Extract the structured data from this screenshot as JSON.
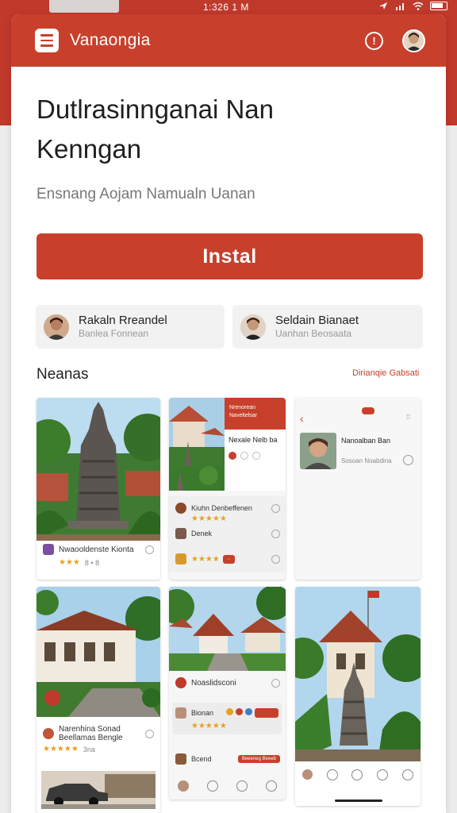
{
  "status_bar": {
    "time": "1:326 1 M"
  },
  "header": {
    "app_name": "Vanaongia",
    "info_glyph": "!"
  },
  "hero": {
    "title_line1": "Dutlrasinnganai Nan",
    "title_line2": "Kenngan",
    "subtitle": "Ensnang Aojam Namualn Uanan",
    "install_label": "Instal"
  },
  "contacts": [
    {
      "name": "Rakaln Rreandel",
      "role": "Banlea Fonnean"
    },
    {
      "name": "Seldain Bianaet",
      "role": "Uanhan Beosaata"
    }
  ],
  "section": {
    "title": "Neanas",
    "link": "Dirianqie Gabsati"
  },
  "tiles": {
    "t1": {
      "title": "Nwaooldenste Kionta",
      "meta": "8 • 8"
    },
    "t2": {
      "header_title": "Nrenorean Naveltelsar",
      "caption": "Nexale Nelb ba",
      "row1": "Kiuhn Denbeffenen",
      "row2": "Denek",
      "badge": "··"
    },
    "t3": {
      "title": "Nanoalban Ban",
      "sub": "Sosoan Noabdina"
    },
    "t4": {
      "title": "Narenhina Sonad",
      "title2": "Beellamas Bengle",
      "meta": "3na"
    },
    "t5": {
      "title": "Noaslidsconi",
      "row1": "Bionan",
      "row2": "Bcend",
      "btn": "Beeeneg Beeeb"
    }
  },
  "icons": {
    "menu": "hamburger-menu-icon",
    "info": "info-icon",
    "back": "chevron-left-icon",
    "grid": "grid-dots-icon"
  },
  "colors": {
    "brand": "#c8402c",
    "star": "#e8a020"
  }
}
